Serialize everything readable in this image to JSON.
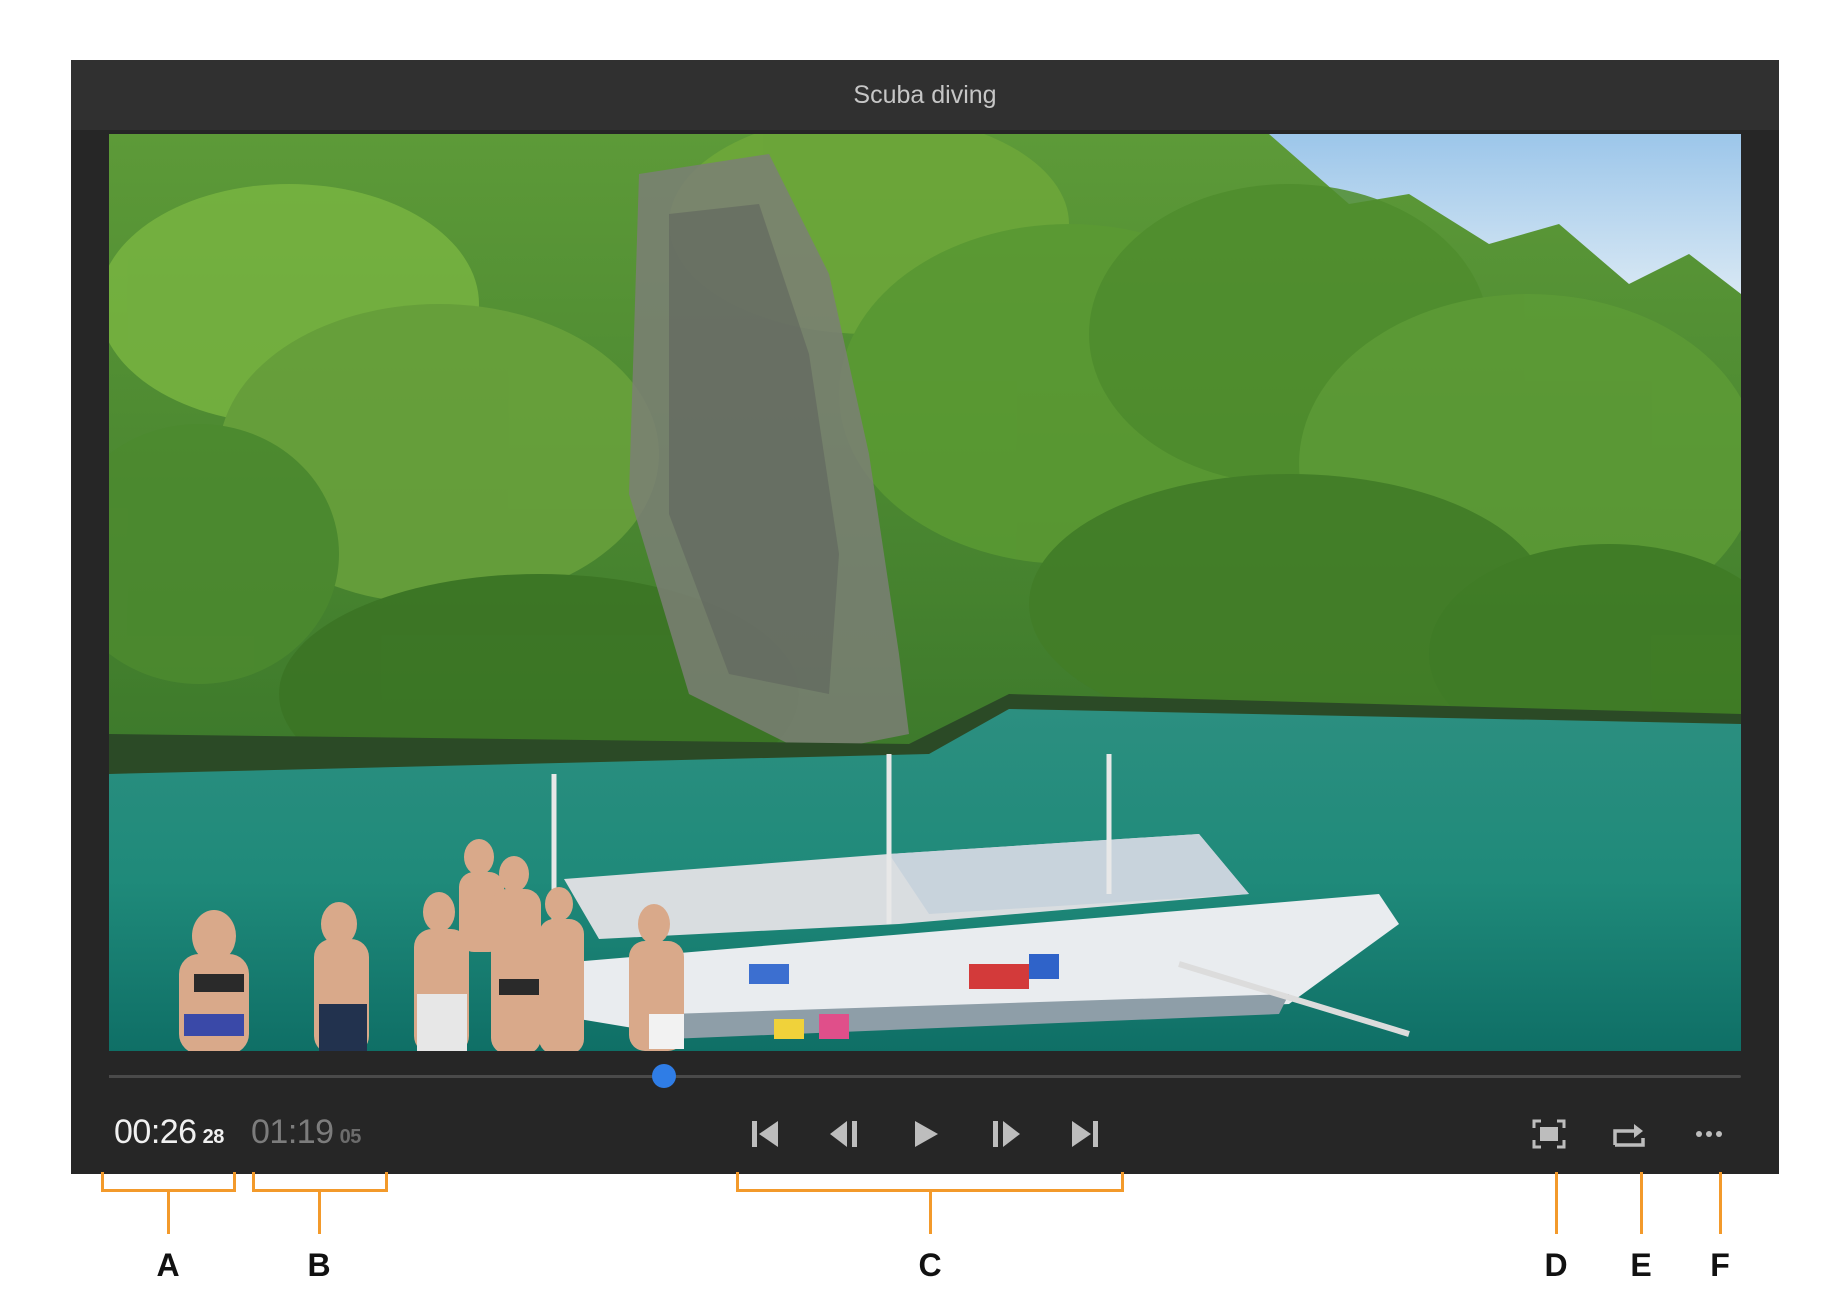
{
  "player": {
    "title": "Scuba diving",
    "current_time": "00:26",
    "current_frames": "28",
    "duration_time": "01:19",
    "duration_frames": "05",
    "playhead_fraction": 0.34,
    "controls": [
      {
        "name": "go-to-start-button",
        "icon": "skip-to-start-icon"
      },
      {
        "name": "step-back-button",
        "icon": "step-back-icon"
      },
      {
        "name": "play-button",
        "icon": "play-icon"
      },
      {
        "name": "step-forward-button",
        "icon": "step-forward-icon"
      },
      {
        "name": "go-to-end-button",
        "icon": "skip-to-end-icon"
      }
    ],
    "right_controls": [
      {
        "name": "fit-to-screen-button",
        "icon": "fit-screen-icon"
      },
      {
        "name": "loop-button",
        "icon": "loop-icon"
      },
      {
        "name": "more-options-button",
        "icon": "more-icon"
      }
    ],
    "accent_color": "#2f7de6"
  },
  "callouts": {
    "a": "A",
    "b": "B",
    "c": "C",
    "d": "D",
    "e": "E",
    "f": "F",
    "color": "#f39a2b"
  }
}
